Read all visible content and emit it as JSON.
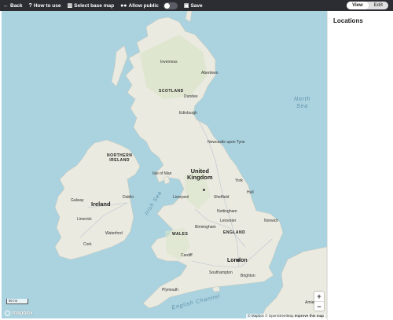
{
  "toolbar": {
    "items": [
      {
        "icon": "arrow-left-icon",
        "glyph": "←",
        "label": "Back"
      },
      {
        "icon": "question-icon",
        "glyph": "?",
        "label": "How to use"
      },
      {
        "icon": "map-icon",
        "glyph": "▥",
        "label": "Select base map"
      },
      {
        "icon": "users-icon",
        "glyph": "👥",
        "label": "Allow public"
      },
      {
        "icon": "save-icon",
        "glyph": "▣",
        "label": "Save"
      }
    ],
    "allow_public_enabled": false,
    "view_label": "View",
    "edit_label": "Edit",
    "active_mode": "View"
  },
  "map": {
    "sea_labels": {
      "north_sea": [
        "North",
        "Sea"
      ],
      "irish_sea": "Irish Sea",
      "english_channel": "English Channel"
    },
    "countries": {
      "uk": [
        "United",
        "Kingdom"
      ],
      "ireland": "Ireland"
    },
    "regions": {
      "scotland": "SCOTLAND",
      "northern_ireland": [
        "NORTHERN",
        "IRELAND"
      ],
      "wales": "WALES",
      "england": "ENGLAND"
    },
    "cities": {
      "inverness": "Inverness",
      "aberdeen": "Aberdeen",
      "dundee": "Dundee",
      "edinburgh": "Edinburgh",
      "newcastle": "Newcastle upon Tyne",
      "isle_of_man": "Isle of Man",
      "york": "York",
      "hull": "Hull",
      "liverpool": "Liverpool",
      "sheffield": "Sheffield",
      "nottingham": "Nottingham",
      "norwich": "Norwich",
      "leicester": "Leicester",
      "birmingham": "Birmingham",
      "cardiff": "Cardiff",
      "london": "London",
      "southampton": "Southampton",
      "brighton": "Brighton",
      "plymouth": "Plymouth",
      "dublin": "Dublin",
      "galway": "Galway",
      "limerick": "Limerick",
      "waterford": "Waterford",
      "cork": "Cork",
      "amiens": "Amiens"
    },
    "scale_label": "90 mi",
    "logo_text": "mapbox",
    "attribution": {
      "mapbox": "© Mapbox",
      "osm": "© OpenStreetMap",
      "improve": "Improve this map"
    },
    "zoom_in": "+",
    "zoom_out": "−"
  },
  "panel": {
    "title": "Locations"
  },
  "colors": {
    "toolbar_bg": "#2b2d33",
    "water": "#aad3df",
    "land": "#eaeae0"
  }
}
